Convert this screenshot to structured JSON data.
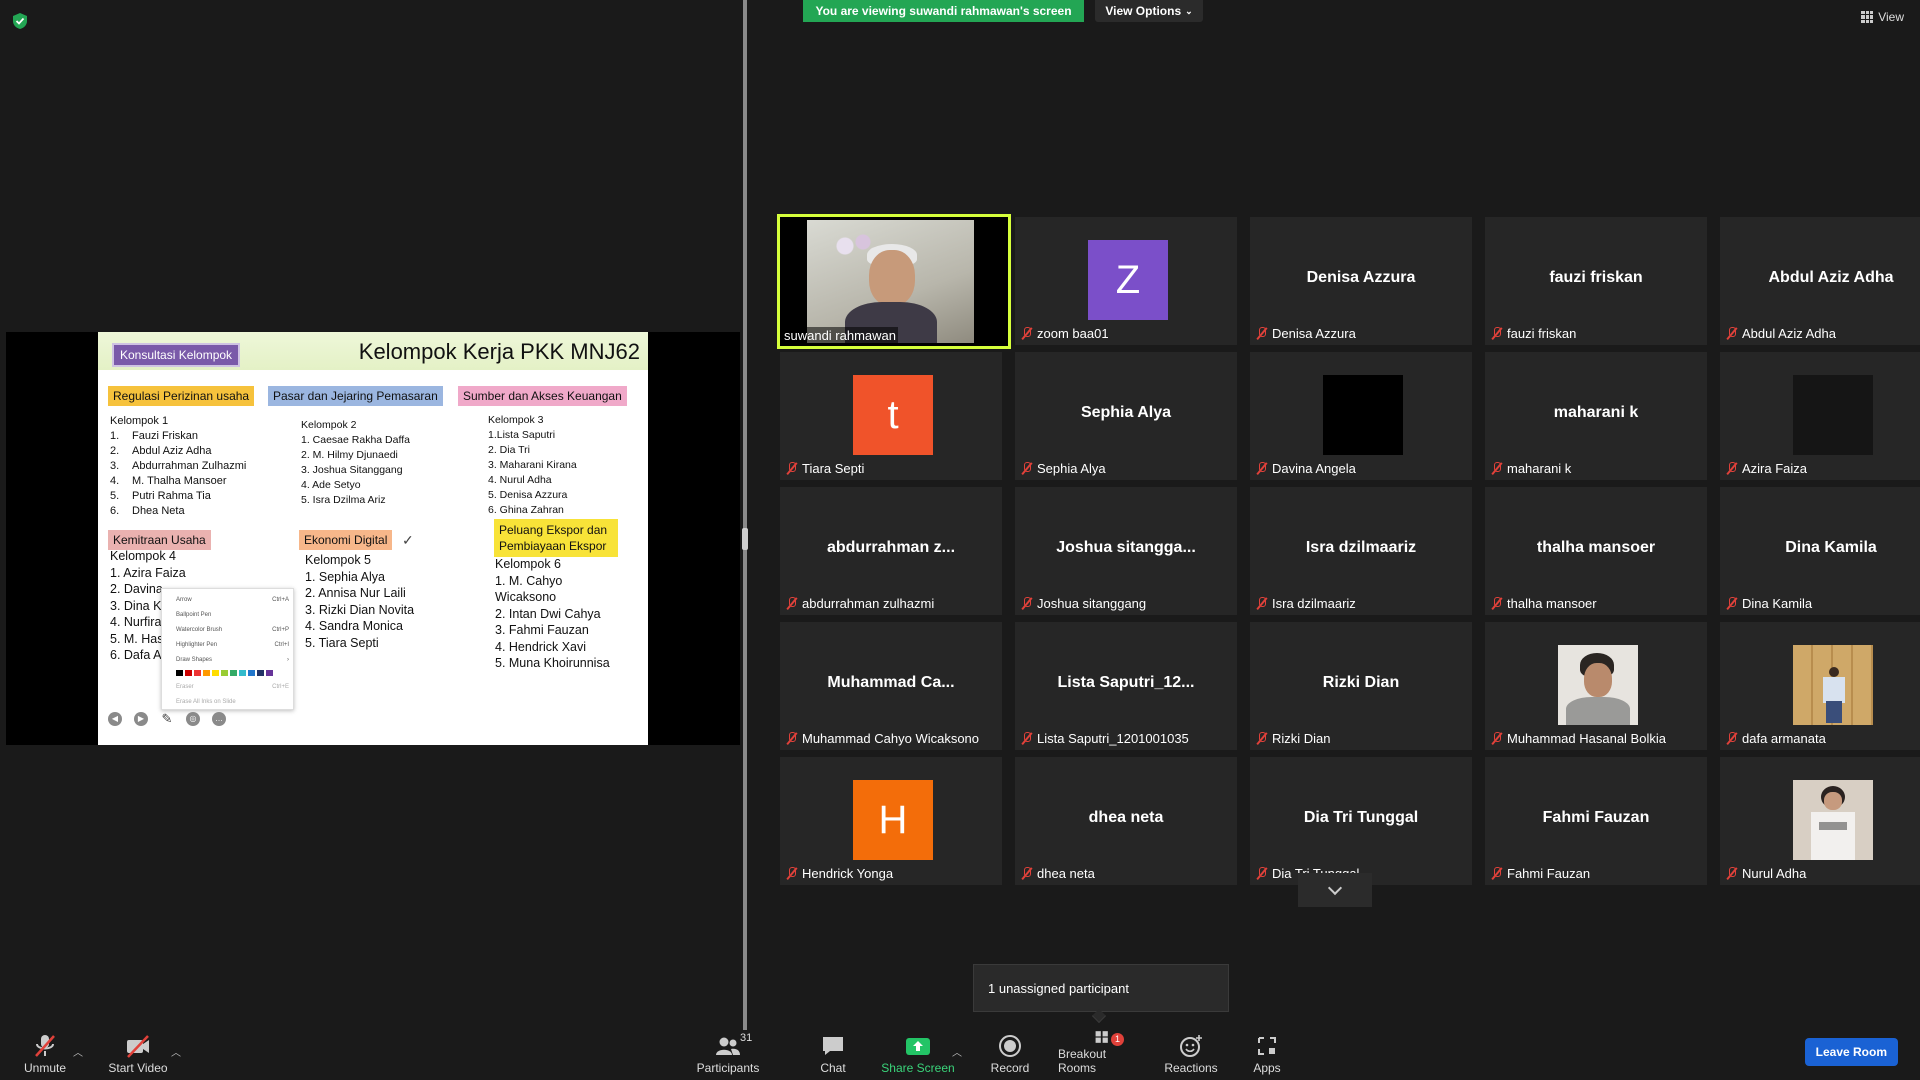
{
  "top": {
    "banner": "You are viewing suwandi rahmawan's screen",
    "view_options": "View Options",
    "view": "View"
  },
  "slide": {
    "tag": "Konsultasi Kelompok",
    "title": "Kelompok Kerja PKK MNJ62",
    "categories": {
      "c1": "Regulasi Perizinan usaha",
      "c2": "Pasar dan  Jejaring Pemasaran",
      "c3": "Sumber dan Akses Keuangan",
      "c4": "Kemitraan Usaha",
      "c5": "Ekonomi Digital",
      "c6": "Peluang Ekspor dan Pembiayaan Ekspor"
    },
    "g1": {
      "head": "Kelompok 1",
      "items": [
        {
          "n": "1.",
          "t": "Fauzi Friskan"
        },
        {
          "n": "2.",
          "t": "Abdul Aziz Adha"
        },
        {
          "n": "3.",
          "t": "Abdurrahman Zulhazmi"
        },
        {
          "n": "4.",
          "t": "M. Thalha Mansoer"
        },
        {
          "n": "5.",
          "t": "Putri Rahma Tia"
        },
        {
          "n": "6.",
          "t": "Dhea Neta"
        }
      ]
    },
    "g2": [
      "Kelompok 2",
      "1. Caesae Rakha Daffa",
      "2. M. Hilmy Djunaedi",
      "3. Joshua Sitanggang",
      "4. Ade Setyo",
      "5. Isra Dzilma Ariz"
    ],
    "g3": [
      "Kelompok 3",
      "1.Lista Saputri",
      "2. Dia Tri",
      "3. Maharani Kirana",
      "4. Nurul Adha",
      "5. Denisa Azzura",
      "6. Ghina Zahran"
    ],
    "g4": [
      "Kelompok 4",
      "1. Azira Faiza",
      "2. Davina",
      "3. Dina K",
      "4. Nurfira",
      "5. M. Has",
      "6. Dafa A"
    ],
    "g5": [
      "Kelompok 5",
      "1. Sephia Alya",
      "2. Annisa Nur Laili",
      "3. Rizki Dian Novita",
      "4. Sandra Monica",
      "5. Tiara Septi"
    ],
    "g6": [
      "Kelompok 6",
      "1. M. Cahyo",
      "Wicaksono",
      "2. Intan Dwi Cahya",
      "3. Fahmi Fauzan",
      "4. Hendrick Xavi",
      "5. Muna Khoirunnisa"
    ],
    "pen_menu": [
      {
        "label": "Arrow",
        "key": "Ctrl+A"
      },
      {
        "label": "Ballpoint Pen",
        "key": ""
      },
      {
        "label": "Watercolor Brush",
        "key": "Ctrl+P"
      },
      {
        "label": "Highlighter Pen",
        "key": "Ctrl+I"
      },
      {
        "label": "Draw Shapes",
        "key": "›"
      }
    ],
    "pen_menu_dim": [
      {
        "label": "Eraser",
        "key": "Ctrl+E"
      },
      {
        "label": "Erase All Inks on Slide",
        "key": ""
      }
    ]
  },
  "colors": {
    "active_border": "#d6ff3b",
    "banner": "#23a654",
    "leave": "#1a62d4",
    "muted": "#e0413a"
  },
  "participants": [
    {
      "label": "suwandi rahmawan",
      "center": "",
      "type": "video",
      "muted": false
    },
    {
      "label": "zoom baa01",
      "center": "",
      "type": "avatar",
      "letter": "Z",
      "color": "#7b4fc9",
      "muted": true
    },
    {
      "label": "Denisa Azzura",
      "center": "Denisa Azzura",
      "type": "name",
      "muted": true
    },
    {
      "label": "fauzi friskan",
      "center": "fauzi friskan",
      "type": "name",
      "muted": true
    },
    {
      "label": "Abdul Aziz Adha",
      "center": "Abdul Aziz Adha",
      "type": "name",
      "muted": true
    },
    {
      "label": "Tiara Septi",
      "center": "",
      "type": "avatar",
      "letter": "t",
      "color": "#f0532a",
      "muted": true
    },
    {
      "label": "Sephia Alya",
      "center": "Sephia Alya",
      "type": "name",
      "muted": true
    },
    {
      "label": "Davina Angela",
      "center": "",
      "type": "avatar",
      "letter": "",
      "color": "#000000",
      "muted": true
    },
    {
      "label": "maharani k",
      "center": "maharani k",
      "type": "name",
      "muted": true
    },
    {
      "label": "Azira Faiza",
      "center": "",
      "type": "avatar",
      "letter": "",
      "color": "#151515",
      "muted": true
    },
    {
      "label": "abdurrahman zulhazmi",
      "center": "abdurrahman  z...",
      "type": "name",
      "muted": true
    },
    {
      "label": "Joshua sitanggang",
      "center": "Joshua  sitangga...",
      "type": "name",
      "muted": true
    },
    {
      "label": "Isra dzilmaariz",
      "center": "Isra dzilmaariz",
      "type": "name",
      "muted": true
    },
    {
      "label": "thalha mansoer",
      "center": "thalha mansoer",
      "type": "name",
      "muted": true
    },
    {
      "label": "Dina Kamila",
      "center": "Dina Kamila",
      "type": "name",
      "muted": true
    },
    {
      "label": "Muhammad Cahyo Wicaksono",
      "center": "Muhammad  Ca...",
      "type": "name",
      "muted": true
    },
    {
      "label": "Lista Saputri_1201001035",
      "center": "Lista  Saputri_12...",
      "type": "name",
      "muted": true
    },
    {
      "label": "Rizki Dian",
      "center": "Rizki Dian",
      "type": "name",
      "muted": true
    },
    {
      "label": "Muhammad Hasanal Bolkia",
      "center": "",
      "type": "photo",
      "photo": "boy",
      "muted": true
    },
    {
      "label": "dafa armanata",
      "center": "",
      "type": "photo",
      "photo": "wall",
      "muted": true
    },
    {
      "label": "Hendrick Yonga",
      "center": "",
      "type": "avatar",
      "letter": "H",
      "color": "#f36d0a",
      "muted": true
    },
    {
      "label": "dhea neta",
      "center": "dhea neta",
      "type": "name",
      "muted": true
    },
    {
      "label": "Dia Tri Tunggal",
      "center": "Dia Tri Tunggal",
      "type": "name",
      "muted": true
    },
    {
      "label": "Fahmi Fauzan",
      "center": "Fahmi Fauzan",
      "type": "name",
      "muted": true
    },
    {
      "label": "Nurul Adha",
      "center": "",
      "type": "photo",
      "photo": "girl",
      "muted": true
    }
  ],
  "tooltip": "1 unassigned participant",
  "toolbar": {
    "unmute": "Unmute",
    "start_video": "Start Video",
    "participants": "Participants",
    "participants_count": "31",
    "chat": "Chat",
    "share_screen": "Share Screen",
    "record": "Record",
    "breakout": "Breakout Rooms",
    "breakout_badge": "1",
    "reactions": "Reactions",
    "apps": "Apps",
    "leave": "Leave Room"
  }
}
